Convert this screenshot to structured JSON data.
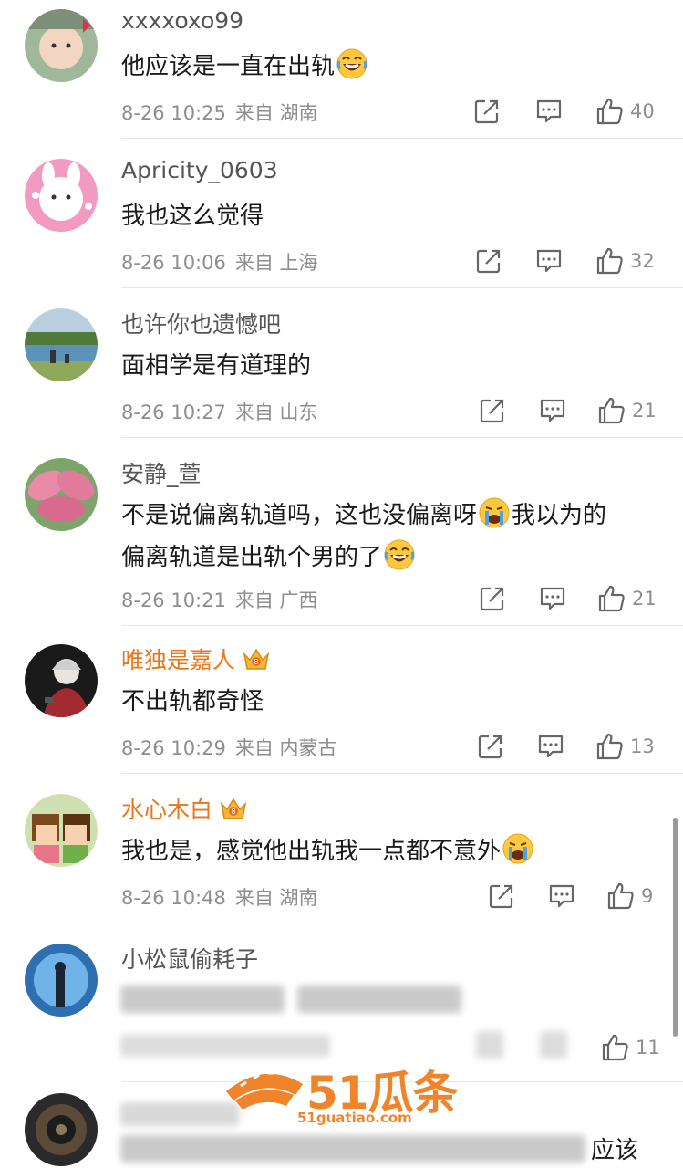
{
  "comments": [
    {
      "username": "xxxxoxo99",
      "text": "他应该是一直在出轨",
      "date": "8-26 10:25",
      "source": "来自 湖南",
      "likes": "40",
      "vip": false
    },
    {
      "username": "Apricity_0603",
      "text": "我也这么觉得",
      "date": "8-26 10:06",
      "source": "来自 上海",
      "likes": "32",
      "vip": false
    },
    {
      "username": "也许你也遗憾吧",
      "text": "面相学是有道理的",
      "date": "8-26 10:27",
      "source": "来自 山东",
      "likes": "21",
      "vip": false
    },
    {
      "username": "安静_萱",
      "text_line1": "不是说偏离轨道吗，这也没偏离呀",
      "text_line1b": "我以为的",
      "text_line2": "偏离轨道是出轨个男的了",
      "date": "8-26 10:21",
      "source": "来自 广西",
      "likes": "21",
      "vip": false
    },
    {
      "username": "唯独是嘉人",
      "text": "不出轨都奇怪",
      "date": "8-26 10:29",
      "source": "来自 内蒙古",
      "likes": "13",
      "vip": true
    },
    {
      "username": "水心木白",
      "text": "我也是，感觉他出轨我一点都不意外",
      "date": "8-26 10:48",
      "source": "来自 湖南",
      "likes": "9",
      "vip": true
    },
    {
      "username": "小松鼠偷耗子",
      "likes": "11",
      "vip": false
    },
    {
      "partial_text": "应该"
    }
  ],
  "watermark": {
    "brand": "51瓜条",
    "url": "51guatiao.com"
  },
  "colors": {
    "vip_name": "#e8771b",
    "meta": "#8e8e8e",
    "watermark": "#f0842a"
  },
  "icons": [
    "share-icon",
    "comment-icon",
    "like-icon",
    "crown-icon",
    "laugh-emoji-icon",
    "cry-emoji-icon"
  ]
}
